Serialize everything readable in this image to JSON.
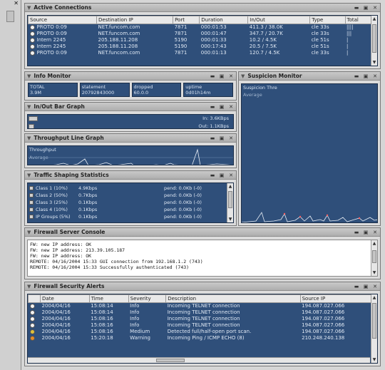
{
  "sidebar": {
    "close_glyph": "✕"
  },
  "active_connections": {
    "title": "Active Connections",
    "columns": [
      "Source",
      "Destination IP",
      "Port",
      "Duration",
      "In/Out",
      "Type",
      "Total"
    ],
    "rows": [
      [
        "PROTO 0:09",
        "NET.funcom.com",
        "7871",
        "000:01:53",
        "411.3 / 38.0K",
        "cle 33s",
        "||||"
      ],
      [
        "PROTO 0:09",
        "NET.funcom.com",
        "7871",
        "000:01:47",
        "347.7 / 20.7K",
        "cle 33s",
        "|||"
      ],
      [
        "Intern 2245",
        "205.188.11.208",
        "5190",
        "000:01:33",
        "10.2 / 4.5K",
        "cle 51s",
        "|"
      ],
      [
        "Intern 2245",
        "205.188.11.208",
        "5190",
        "000:17:43",
        "20.5 / 7.5K",
        "cle 51s",
        "|"
      ],
      [
        "PROTO 0:09",
        "NET.funcom.com",
        "7871",
        "000:01:13",
        "120.7 / 4.5K",
        "cle 33s",
        "|"
      ]
    ]
  },
  "info_monitor": {
    "title": "Info Monitor",
    "fields": [
      {
        "label": "TOTAL",
        "value": "3.9M"
      },
      {
        "label": "statement",
        "value": "20792843000"
      },
      {
        "label": "dropped",
        "value": "60.0.0"
      },
      {
        "label": "uptime",
        "value": "0d01h14m"
      }
    ]
  },
  "inout_bar_graph": {
    "title": "In/Out Bar Graph",
    "in_label": "In: 3.6KBps",
    "out_label": "Out: 1.1KBps",
    "in_level": 0.05,
    "out_level": 0.03
  },
  "throughput_line_graph": {
    "title": "Throughput Line Graph",
    "label_a": "Throughput",
    "label_b": "Average"
  },
  "suspicion_monitor": {
    "title": "Suspicion Monitor",
    "label_a": "Suspicion Thre",
    "label_b": "Average"
  },
  "traffic_shaping": {
    "title": "Traffic Shaping Statistics",
    "rows": [
      {
        "name": "Class 1 (10%)",
        "rate": "4.9Kbps",
        "pend": "pend: 0.0Kb (-0)"
      },
      {
        "name": "Class 2 (50%)",
        "rate": "0.7Kbps",
        "pend": "pend: 0.0Kb (-0)"
      },
      {
        "name": "Class 3 (25%)",
        "rate": "0.1Kbps",
        "pend": "pend: 0.0Kb (-0)"
      },
      {
        "name": "Class 4 (10%)",
        "rate": "0.1Kbps",
        "pend": "pend: 0.0Kb (-0)"
      },
      {
        "name": "IP Groups (5%)",
        "rate": "0.1Kbps",
        "pend": "pend: 0.0Kb (-0)"
      }
    ]
  },
  "firewall_console": {
    "title": "Firewall Server Console",
    "lines": [
      "FW: new IP address: OK",
      "FW: new IP address: 213.39.105.187",
      "FW: new IP address: OK",
      "REMOTE: 04/16/2004 15:33 GUI connection from 192.168.1.2 (743)",
      "REMOTE: 04/16/2004 15:33 Successfully authenticated (743)"
    ]
  },
  "security_alerts": {
    "title": "Firewall Security Alerts",
    "columns": [
      "",
      "Date",
      "Time",
      "Severity",
      "Description",
      "Source IP"
    ],
    "rows": [
      {
        "level": "info",
        "date": "2004/04/16",
        "time": "15:08:14",
        "severity": "Info",
        "desc": "Incoming TELNET connection",
        "src": "194.087.027.066"
      },
      {
        "level": "info",
        "date": "2004/04/16",
        "time": "15:08:14",
        "severity": "Info",
        "desc": "Incoming TELNET connection",
        "src": "194.087.027.066"
      },
      {
        "level": "info",
        "date": "2004/04/16",
        "time": "15:08:16",
        "severity": "Info",
        "desc": "Incoming TELNET connection",
        "src": "194.087.027.066"
      },
      {
        "level": "info",
        "date": "2004/04/16",
        "time": "15:08:16",
        "severity": "Info",
        "desc": "Incoming TELNET connection",
        "src": "194.087.027.066"
      },
      {
        "level": "mid",
        "date": "2004/04/16",
        "time": "15:08:16",
        "severity": "Medium",
        "desc": "Detected full/half-open port scan.",
        "src": "194.087.027.066"
      },
      {
        "level": "warn",
        "date": "2004/04/16",
        "time": "15:20:18",
        "severity": "Warning",
        "desc": "Incoming Ping / ICMP ECHO (8)",
        "src": "210.248.240.138"
      }
    ]
  }
}
